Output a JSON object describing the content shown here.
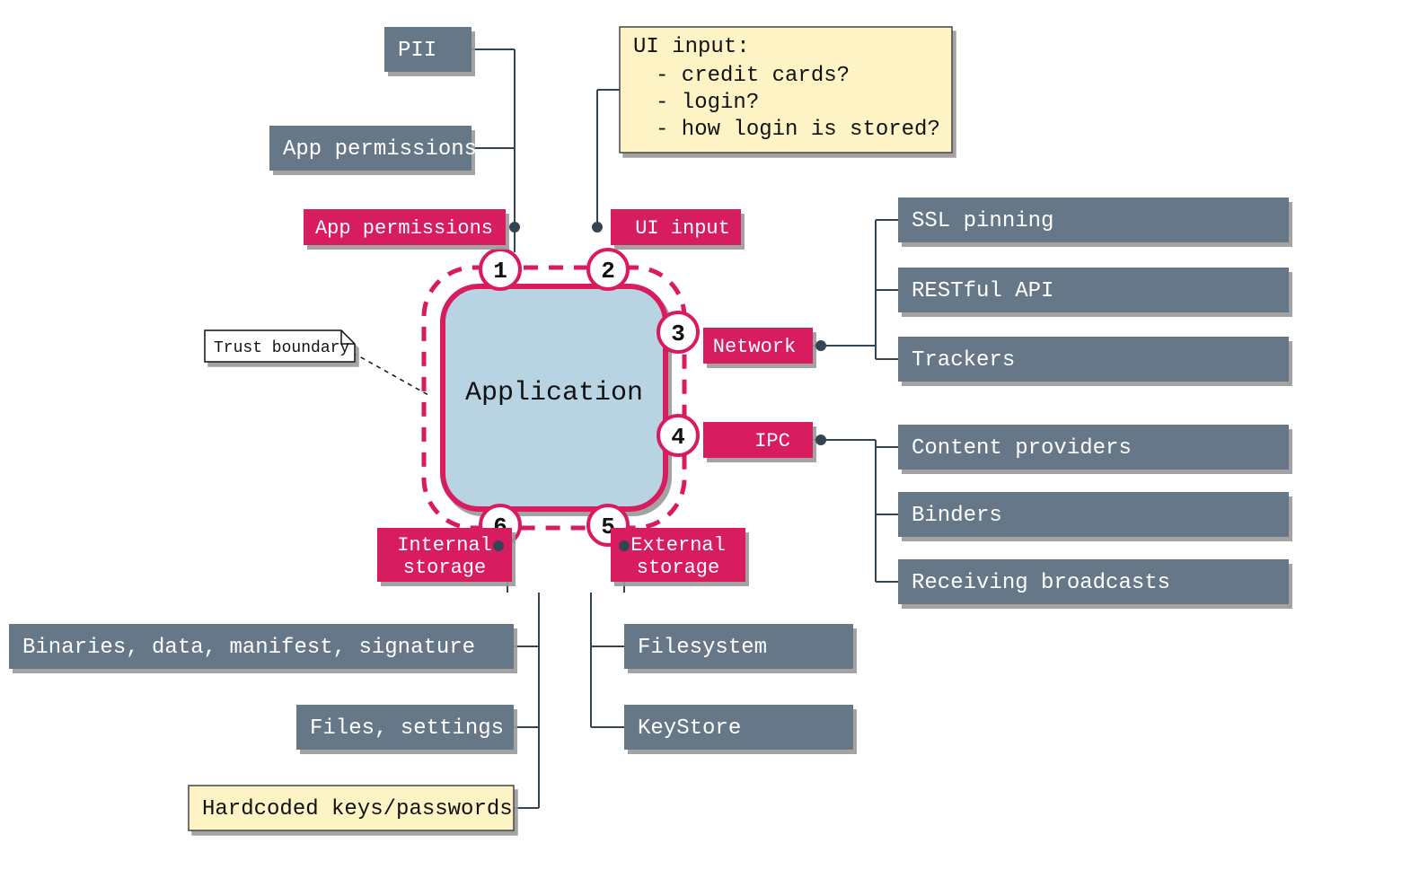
{
  "center": {
    "label": "Application"
  },
  "trust_boundary_label": "Trust boundary",
  "ports": {
    "1": {
      "num": "1",
      "label": "App permissions"
    },
    "2": {
      "num": "2",
      "label": "UI input"
    },
    "3": {
      "num": "3",
      "label": "Network"
    },
    "4": {
      "num": "4",
      "label": "IPC"
    },
    "5": {
      "num": "5",
      "label": "External\nstorage",
      "line1": "External",
      "line2": "storage"
    },
    "6": {
      "num": "6",
      "label": "Internal\nstorage",
      "line1": "Internal",
      "line2": "storage"
    }
  },
  "leaves": {
    "pii": "PII",
    "app_permissions_top": "App permissions",
    "ui_input_note": {
      "title": "UI input:",
      "items": [
        "- credit cards?",
        "- login?",
        "- how login is stored?"
      ]
    },
    "network": [
      "SSL pinning",
      "RESTful API",
      "Trackers"
    ],
    "ipc": [
      "Content providers",
      "Binders",
      "Receiving broadcasts"
    ],
    "external_storage": [
      "Filesystem",
      "KeyStore"
    ],
    "internal_storage": {
      "grey": [
        "Binaries, data, manifest, signature",
        "Files, settings"
      ],
      "yellow": "Hardcoded keys/passwords"
    }
  }
}
